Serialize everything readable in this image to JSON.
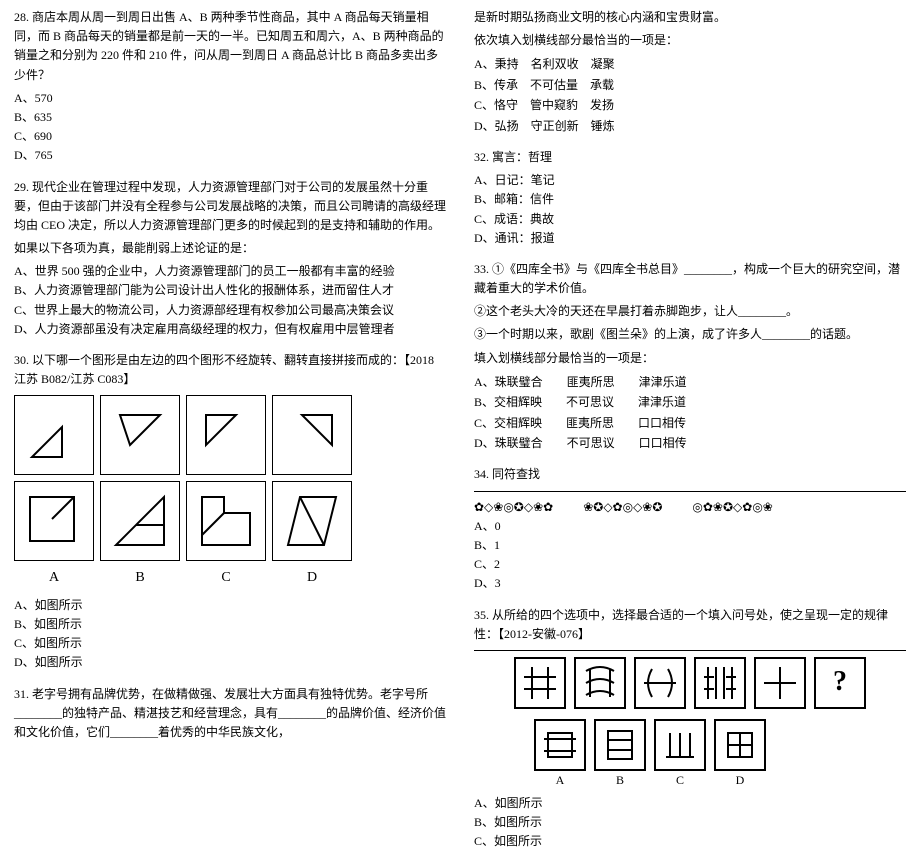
{
  "left": {
    "q28": {
      "stem": "28. 商店本周从周一到周日出售 A、B 两种季节性商品，其中 A 商品每天销量相同，而 B 商品每天的销量都是前一天的一半。已知周五和周六，A、B 两种商品的销量之和分别为 220 件和 210 件，问从周一到周日 A 商品总计比 B 商品多卖出多少件？",
      "A": "A、570",
      "B": "B、635",
      "C": "C、690",
      "D": "D、765"
    },
    "q29": {
      "stem": "29. 现代企业在管理过程中发现，人力资源管理部门对于公司的发展虽然十分重要，但由于该部门并没有全程参与公司发展战略的决策，而且公司聘请的高级经理均由 CEO 决定，所以人力资源管理部门更多的时候起到的是支持和辅助的作用。",
      "sub": "如果以下各项为真，最能削弱上述论证的是：",
      "A": "A、世界 500 强的企业中，人力资源管理部门的员工一般都有丰富的经验",
      "B": "B、人力资源管理部门能为公司设计出人性化的报酬体系，进而留住人才",
      "C": "C、世界上最大的物流公司，人力资源部经理有权参加公司最高决策会议",
      "D": "D、人力资源部虽没有决定雇用高级经理的权力，但有权雇用中层管理者"
    },
    "q30": {
      "stem": "30. 以下哪一个图形是由左边的四个图形不经旋转、翻转直接拼接而成的：【2018 江苏 B082/江苏 C083】",
      "labA": "A",
      "labB": "B",
      "labC": "C",
      "labD": "D",
      "A": "A、如图所示",
      "B": "B、如图所示",
      "C": "C、如图所示",
      "D": "D、如图所示"
    },
    "q31": {
      "stem": "31. 老字号拥有品牌优势，在做精做强、发展壮大方面具有独特优势。老字号所________的独特产品、精湛技艺和经营理念，具有________的品牌价值、经济价值和文化价值，它们________着优秀的中华民族文化，"
    }
  },
  "right": {
    "q31c": {
      "line1": "是新时期弘扬商业文明的核心内涵和宝贵财富。",
      "line2": "依次填入划横线部分最恰当的一项是：",
      "A": "A、秉持    名利双收    凝聚",
      "B": "B、传承    不可估量    承载",
      "C": "C、恪守    管中窥豹    发扬",
      "D": "D、弘扬    守正创新    锤炼"
    },
    "q32": {
      "stem": "32. 寓言：哲理",
      "A": "A、日记：笔记",
      "B": "B、邮箱：信件",
      "C": "C、成语：典故",
      "D": "D、通讯：报道"
    },
    "q33": {
      "stem": "33. ①《四库全书》与《四库全书总目》________，构成一个巨大的研究空间，潜藏着重大的学术价值。",
      "l2": "   ②这个老头大冷的天还在早晨打着赤脚跑步，让人________。",
      "l3": "   ③一个时期以来，歌剧《图兰朵》的上演，成了许多人________的话题。",
      "l4": "   填入划横线部分最恰当的一项是：",
      "A": "A、珠联璧合        匪夷所思        津津乐道",
      "B": "B、交相辉映        不可思议        津津乐道",
      "C": "C、交相辉映        匪夷所思        口口相传",
      "D": "D、珠联璧合        不可思议        口口相传"
    },
    "q34": {
      "stem": "34. 同符查找",
      "sym1": "✿◇❀◎✪◇❀✿",
      "sym2": "❀✪◇✿◎◇❀✪",
      "sym3": "◎✿❀✪◇✿◎❀",
      "A": "A、0",
      "B": "B、1",
      "C": "C、2",
      "D": "D、3"
    },
    "q35": {
      "stem": "35. 从所给的四个选项中，选择最合适的一个填入问号处，使之呈现一定的规律性：【2012-安徽-076】",
      "labA": "A",
      "labB": "B",
      "labC": "C",
      "labD": "D",
      "A": "A、如图所示",
      "B": "B、如图所示",
      "C": "C、如图所示"
    }
  }
}
